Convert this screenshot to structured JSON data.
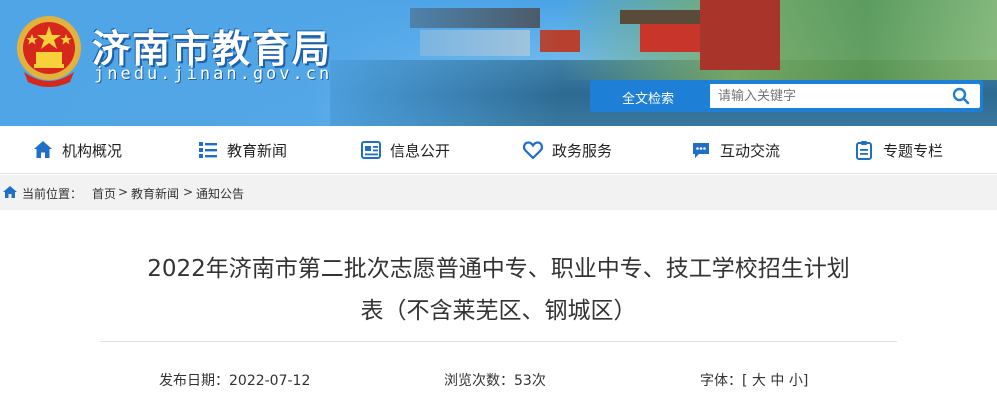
{
  "header": {
    "site_title": "济南市教育局",
    "site_domain": "jnedu.jinan.gov.cn",
    "search": {
      "label": "全文检索",
      "placeholder": "请输入关键字"
    }
  },
  "nav": {
    "items": [
      {
        "label": "机构概况",
        "icon": "home-icon"
      },
      {
        "label": "教育新闻",
        "icon": "list-icon"
      },
      {
        "label": "信息公开",
        "icon": "newspaper-icon"
      },
      {
        "label": "政务服务",
        "icon": "heart-icon"
      },
      {
        "label": "互动交流",
        "icon": "chat-icon"
      },
      {
        "label": "专题专栏",
        "icon": "clipboard-icon"
      }
    ]
  },
  "breadcrumb": {
    "prefix": "当前位置：",
    "items": [
      "首页",
      "教育新闻",
      "通知公告"
    ],
    "separator": ">"
  },
  "article": {
    "title_line1": "2022年济南市第二批次志愿普通中专、职业中专、技工学校招生计划",
    "title_line2": "表（不含莱芜区、钢城区）",
    "publish_date_label": "发布日期：2022-07-12",
    "views_label": "浏览次数：53次",
    "font_size_label": "字体：",
    "font_size_open": "[",
    "font_sizes": [
      "大",
      "中",
      "小"
    ],
    "font_size_close": "]"
  },
  "colors": {
    "banner_blue": "#4aa3e6",
    "search_blue": "#1d7fd6",
    "nav_icon_blue": "#1f6fc6",
    "text_dark": "#333333"
  }
}
